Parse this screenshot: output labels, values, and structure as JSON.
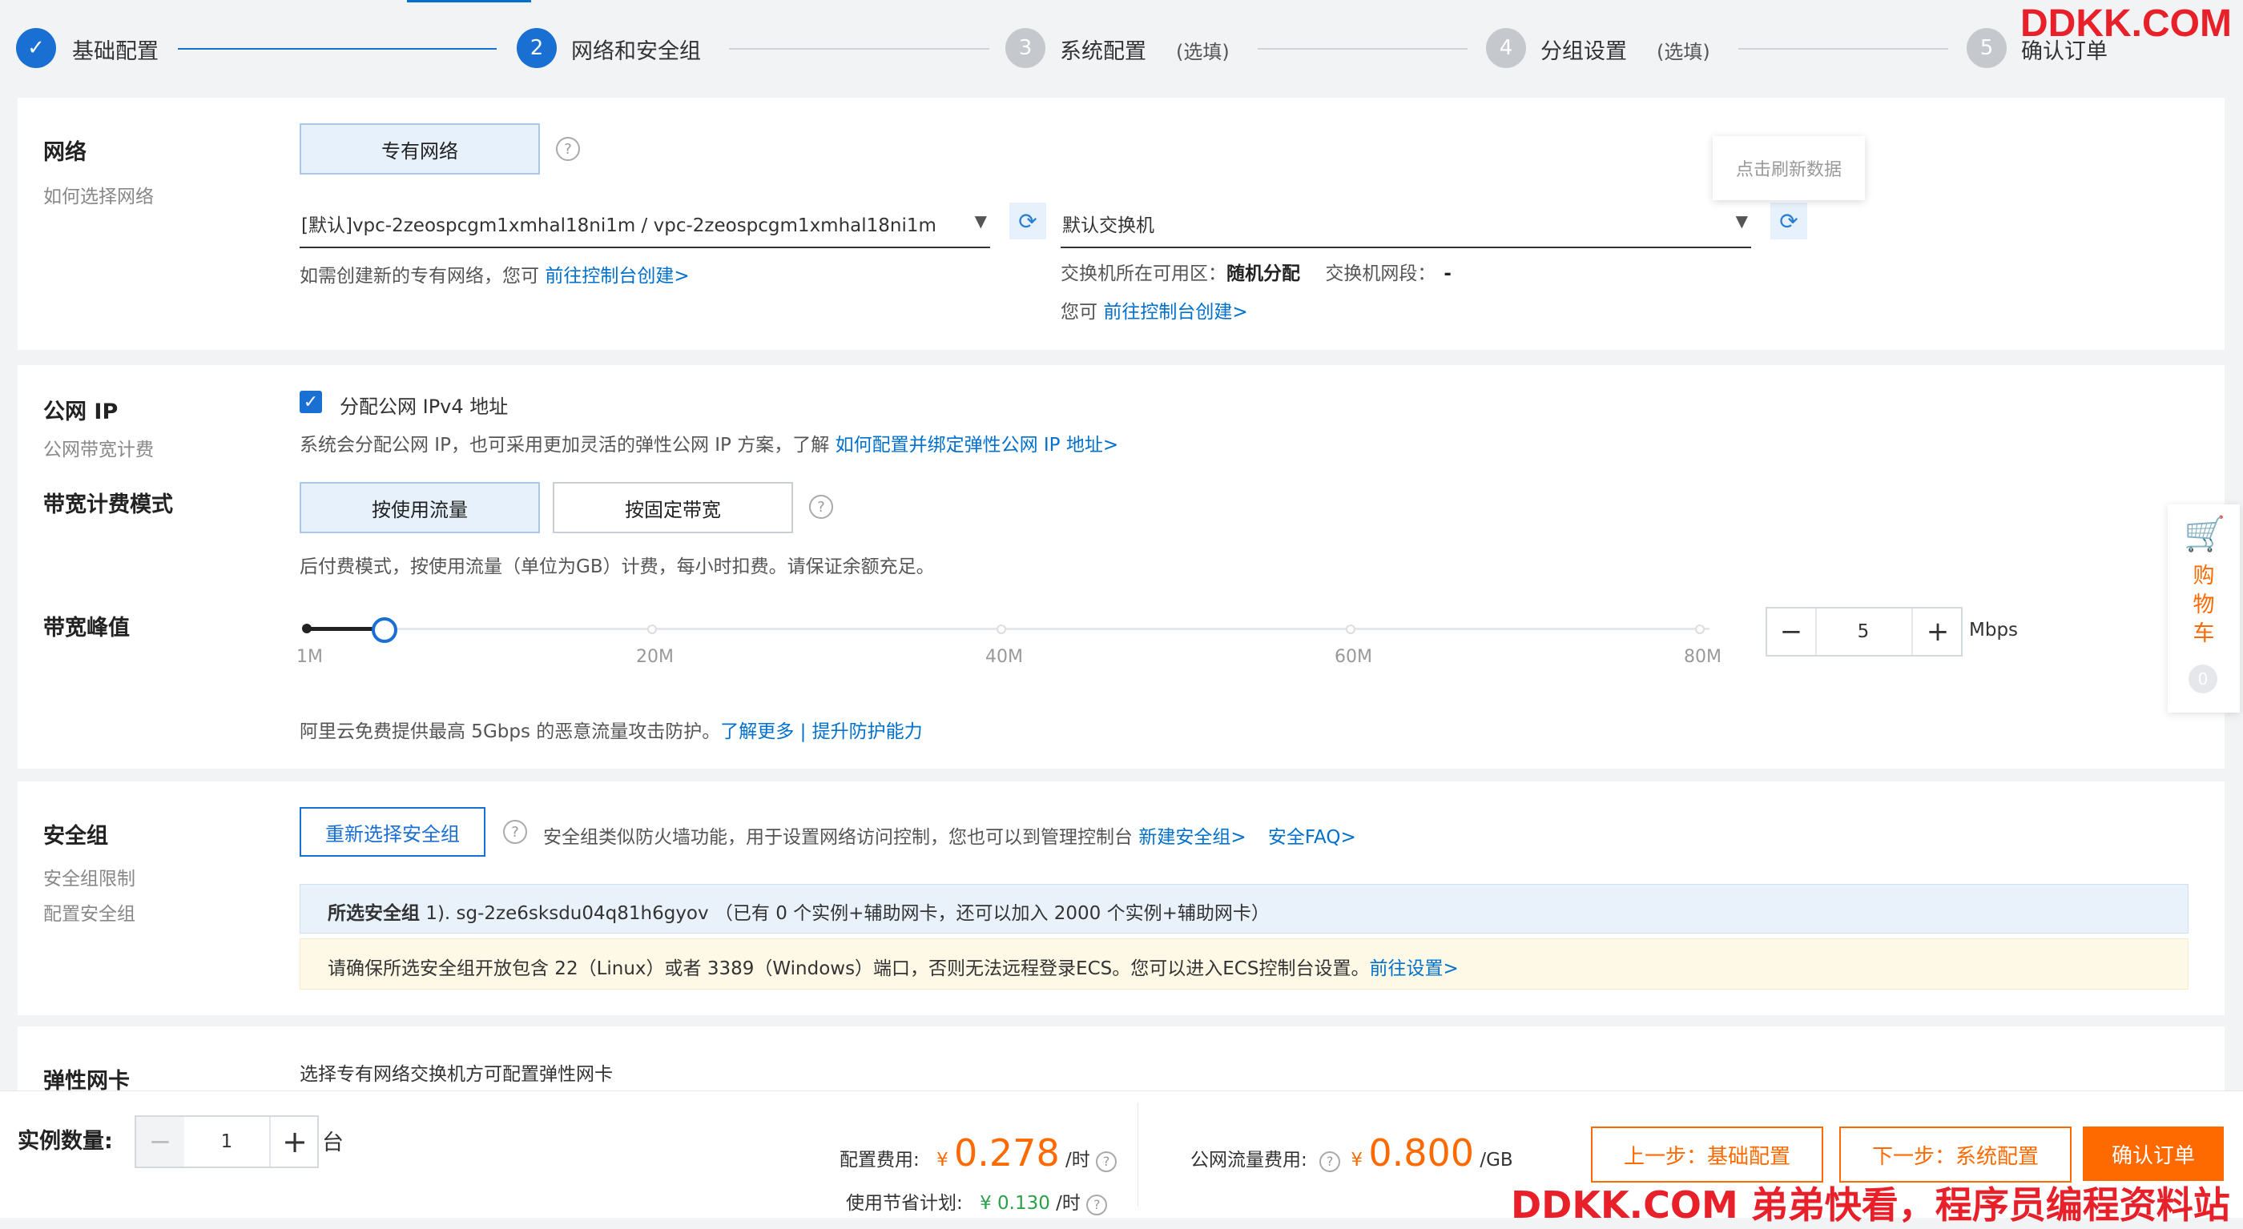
{
  "steps": [
    {
      "num": "✓",
      "label": "基础配置",
      "opt": ""
    },
    {
      "num": "2",
      "label": "网络和安全组",
      "opt": ""
    },
    {
      "num": "3",
      "label": "系统配置",
      "opt": "(选填)"
    },
    {
      "num": "4",
      "label": "分组设置",
      "opt": "(选填)"
    },
    {
      "num": "5",
      "label": "确认订单",
      "opt": ""
    }
  ],
  "watermark_top": "DDKK.COM",
  "watermark_bottom": "DDKK.COM 弟弟快看，程序员编程资料站",
  "network": {
    "title": "网络",
    "subtitle": "如何选择网络",
    "tab": "专有网络",
    "vpc_value": "[默认]vpc-2zeospcgm1xmhal18ni1m / vpc-2zeospcgm1xmhal18ni1m",
    "vpc_hint": "如需创建新的专有网络，您可",
    "vpc_link": "前往控制台创建>",
    "switch_value": "默认交换机",
    "tooltip": "点击刷新数据",
    "zone_label": "交换机所在可用区：",
    "zone_value": "随机分配",
    "segment_label": "交换机网段：",
    "segment_value": "-",
    "switch_hint": "您可",
    "switch_link": "前往控制台创建>"
  },
  "public_ip": {
    "title": "公网 IP",
    "subtitle": "公网带宽计费",
    "checkbox_label": "分配公网 IPv4 地址",
    "checked": true,
    "desc": "系统会分配公网 IP，也可采用更加灵活的弹性公网 IP 方案，了解",
    "desc_link": "如何配置并绑定弹性公网 IP 地址>"
  },
  "billing": {
    "title": "带宽计费模式",
    "tab_traffic": "按使用流量",
    "tab_fixed": "按固定带宽",
    "desc": "后付费模式，按使用流量（单位为GB）计费，每小时扣费。请保证余额充足。"
  },
  "bandwidth": {
    "title": "带宽峰值",
    "ticks": [
      "1M",
      "20M",
      "40M",
      "60M",
      "80M"
    ],
    "value": "5",
    "level": 0.05,
    "unit": "Mbps",
    "minus": "−",
    "plus": "+",
    "desc": "阿里云免费提供最高 5Gbps 的恶意流量攻击防护。",
    "link1": "了解更多",
    "sep": " | ",
    "link2": "提升防护能力"
  },
  "security": {
    "title": "安全组",
    "sub1": "安全组限制",
    "sub2": "配置安全组",
    "button": "重新选择安全组",
    "desc": "安全组类似防火墙功能，用于设置网络访问控制，您也可以到管理控制台",
    "link1": "新建安全组>",
    "link2": "安全FAQ>",
    "selected_label": "所选安全组",
    "selected_value": "1). sg-2ze6sksdu04q81h6gyov （已有 0 个实例+辅助网卡，还可以加入 2000 个实例+辅助网卡）",
    "warning": "请确保所选安全组开放包含 22（Linux）或者 3389（Windows）端口，否则无法远程登录ECS。您可以进入ECS控制台设置。",
    "warning_link": "前往设置>"
  },
  "eni": {
    "title": "弹性网卡",
    "desc": "选择专有网络交换机方可配置弹性网卡"
  },
  "footer": {
    "count_label": "实例数量:",
    "count_value": "1",
    "count_unit": "台",
    "fee_label": "配置费用:",
    "currency": "¥",
    "fee_value": "0.278",
    "fee_unit": "/时",
    "save_label": "使用节省计划:",
    "save_value": "¥ 0.130",
    "save_unit": "/时",
    "traffic_label": "公网流量费用:",
    "traffic_value": "0.800",
    "traffic_unit": "/GB",
    "prev": "上一步：基础配置",
    "next": "下一步：系统配置",
    "confirm": "确认订单"
  },
  "cart": {
    "label": "购物车",
    "count": "0"
  }
}
